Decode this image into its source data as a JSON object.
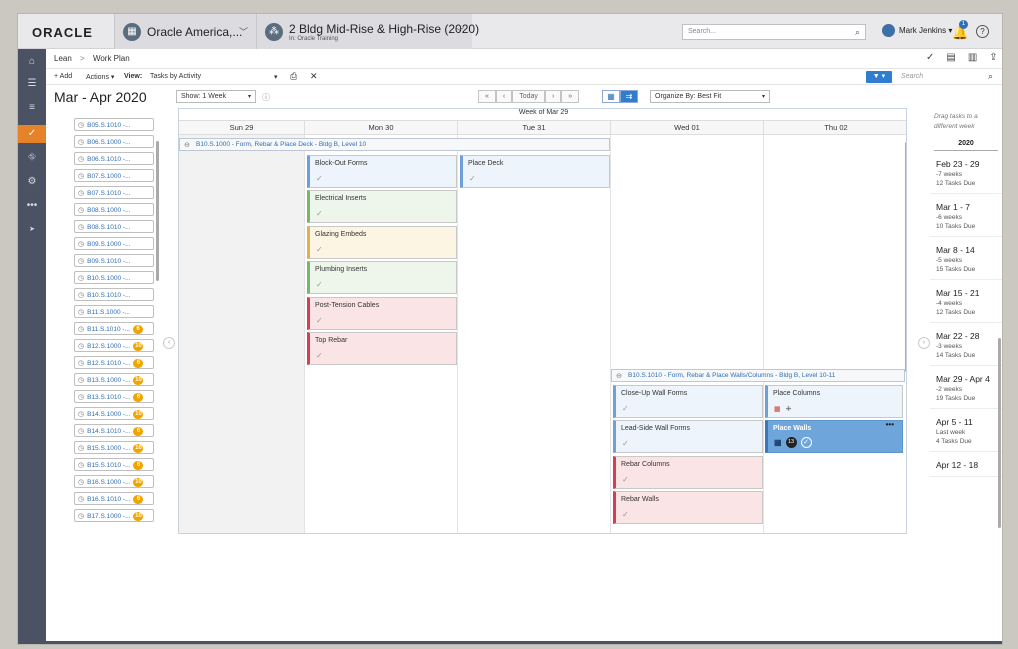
{
  "topbar": {
    "logo": "ORACLE",
    "context1": {
      "label": "Oracle America,...",
      "icon": "building-icon"
    },
    "context2": {
      "label": "2 Bldg Mid-Rise & High-Rise (2020)",
      "sub": "In: Oracle Training",
      "icon": "project-icon"
    },
    "search_placeholder": "Search...",
    "user_name": "Mark Jenkins ▾",
    "notification_count": "1"
  },
  "breadcrumb": {
    "root": "Lean",
    "current": "Work Plan"
  },
  "toolbar": {
    "add": "+ Add",
    "actions": "Actions ▾",
    "view_label": "View:",
    "view_value": "Tasks by Activity",
    "search_placeholder": "Search"
  },
  "datebar": {
    "range": "Mar - Apr 2020",
    "show": "Show: 1 Week",
    "today": "Today",
    "organize": "Organize By: Best Fit"
  },
  "tasklist": [
    {
      "label": "B05.S.1010 -...",
      "count": ""
    },
    {
      "label": "B06.S.1000 -...",
      "count": ""
    },
    {
      "label": "B06.S.1010 -...",
      "count": ""
    },
    {
      "label": "B07.S.1000 -...",
      "count": ""
    },
    {
      "label": "B07.S.1010 -...",
      "count": ""
    },
    {
      "label": "B08.S.1000 -...",
      "count": ""
    },
    {
      "label": "B08.S.1010 -...",
      "count": ""
    },
    {
      "label": "B09.S.1000 -...",
      "count": ""
    },
    {
      "label": "B09.S.1010 -...",
      "count": ""
    },
    {
      "label": "B10.S.1000 -...",
      "count": ""
    },
    {
      "label": "B10.S.1010 -...",
      "count": ""
    },
    {
      "label": "B11.S.1000 -...",
      "count": ""
    },
    {
      "label": "B11.S.1010 -...",
      "count": "6"
    },
    {
      "label": "B12.S.1000 -...",
      "count": "10"
    },
    {
      "label": "B12.S.1010 -...",
      "count": "6"
    },
    {
      "label": "B13.S.1000 -...",
      "count": "10"
    },
    {
      "label": "B13.S.1010 -...",
      "count": "6"
    },
    {
      "label": "B14.S.1000 -...",
      "count": "10"
    },
    {
      "label": "B14.S.1010 -...",
      "count": "6"
    },
    {
      "label": "B15.S.1000 -...",
      "count": "10"
    },
    {
      "label": "B15.S.1010 -...",
      "count": "6"
    },
    {
      "label": "B16.S.1000 -...",
      "count": "10"
    },
    {
      "label": "B16.S.1010 -...",
      "count": "6"
    },
    {
      "label": "B17.S.1000 -...",
      "count": "10"
    }
  ],
  "calendar": {
    "week_label": "Week of Mar 29",
    "days": [
      "Sun 29",
      "Mon 30",
      "Tue 31",
      "Wed 01",
      "Thu 02"
    ],
    "group1": "B10.S.1000 - Form, Rebar & Place Deck - Bldg B, Level 10",
    "group2": "B10.S.1010 - Form, Rebar & Place Walls/Columns - Bldg B, Level 10-11",
    "mon_tasks": [
      "Block-Out Forms",
      "Electrical Inserts",
      "Glazing Embeds",
      "Plumbing Inserts",
      "Post-Tension Cables",
      "Top Rebar"
    ],
    "tue_tasks": [
      "Place Deck"
    ],
    "wed_tasks": [
      "Close-Up Wall Forms",
      "Lead-Side Wall Forms",
      "Rebar Columns",
      "Rebar Walls"
    ],
    "thu_tasks": [
      "Place Columns",
      "Place Walls"
    ],
    "selected_count": "13"
  },
  "rightpanel": {
    "hint": "Drag tasks to a different week",
    "year": "2020",
    "weeks": [
      {
        "range": "Feb 23 - 29",
        "weeks": "-7 weeks",
        "due": "12 Tasks Due"
      },
      {
        "range": "Mar 1 - 7",
        "weeks": "-6 weeks",
        "due": "10 Tasks Due"
      },
      {
        "range": "Mar 8 - 14",
        "weeks": "-5 weeks",
        "due": "15 Tasks Due"
      },
      {
        "range": "Mar 15 - 21",
        "weeks": "-4 weeks",
        "due": "12 Tasks Due"
      },
      {
        "range": "Mar 22 - 28",
        "weeks": "-3 weeks",
        "due": "14 Tasks Due"
      },
      {
        "range": "Mar 29 - Apr 4",
        "weeks": "-2 weeks",
        "due": "19 Tasks Due"
      },
      {
        "range": "Apr 5 - 11",
        "weeks": "Last week",
        "due": "4 Tasks Due"
      },
      {
        "range": "Apr 12 - 18",
        "weeks": "",
        "due": ""
      }
    ]
  },
  "colors": {
    "accent": "#e6822a",
    "primary": "#2f7dd1",
    "nav": "#4b5263"
  }
}
